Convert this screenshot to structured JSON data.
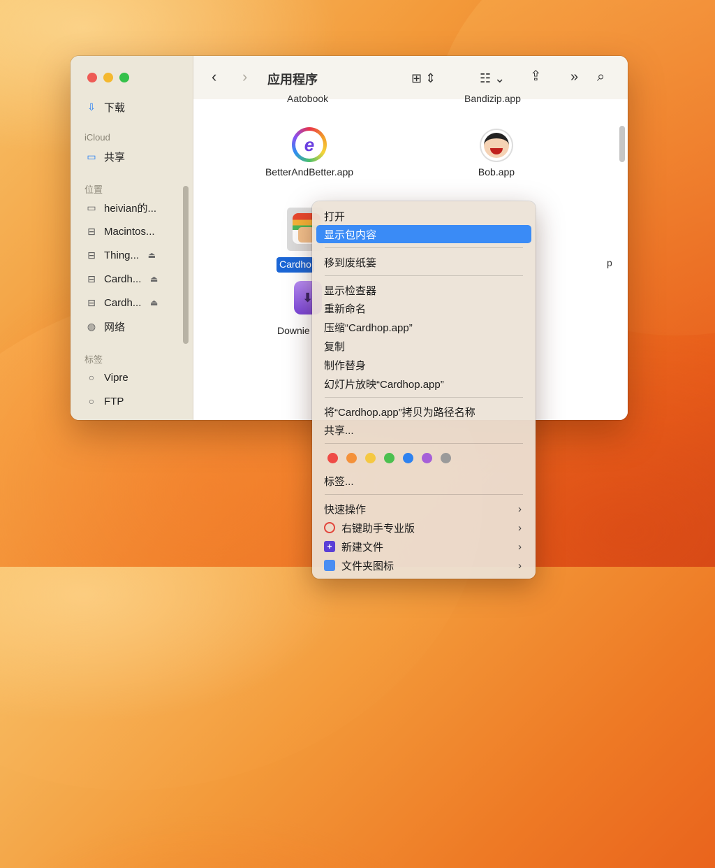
{
  "finder": {
    "title": "应用程序",
    "sidebar": {
      "downloads": "下载",
      "icloud_header": "iCloud",
      "shared": "共享",
      "locations_header": "位置",
      "locations": [
        "heivian的...",
        "Macintos...",
        "Thing...",
        "Cardh...",
        "Cardh..."
      ],
      "network": "网络",
      "tags_header": "标签",
      "tags": [
        "Vipre",
        "FTP"
      ]
    },
    "top_items_cut": [
      "Aatobook",
      "Bandizip.app"
    ],
    "items": {
      "better": "BetterAndBetter.app",
      "bob": "Bob.app",
      "cardhop_sel": "Cardho",
      "right_cut": "p",
      "downie": "Downie"
    }
  },
  "context_menu": {
    "open": "打开",
    "show_package": "显示包内容",
    "trash": "移到废纸篓",
    "inspector": "显示检查器",
    "rename": "重新命名",
    "compress": "压缩“Cardhop.app”",
    "duplicate": "复制",
    "alias": "制作替身",
    "slideshow": "幻灯片放映“Cardhop.app”",
    "copy_path": "将“Cardhop.app”拷贝为路径名称",
    "share": "共享...",
    "tags": "标签...",
    "quick_actions": "快速操作",
    "right_click_pro": "右键助手专业版",
    "new_file": "新建文件",
    "folder_icon": "文件夹图标"
  },
  "tag_colors": [
    "#ef4a45",
    "#f4913a",
    "#f5c842",
    "#4cc04f",
    "#2e82f0",
    "#a65fd8",
    "#9a9a9a"
  ]
}
